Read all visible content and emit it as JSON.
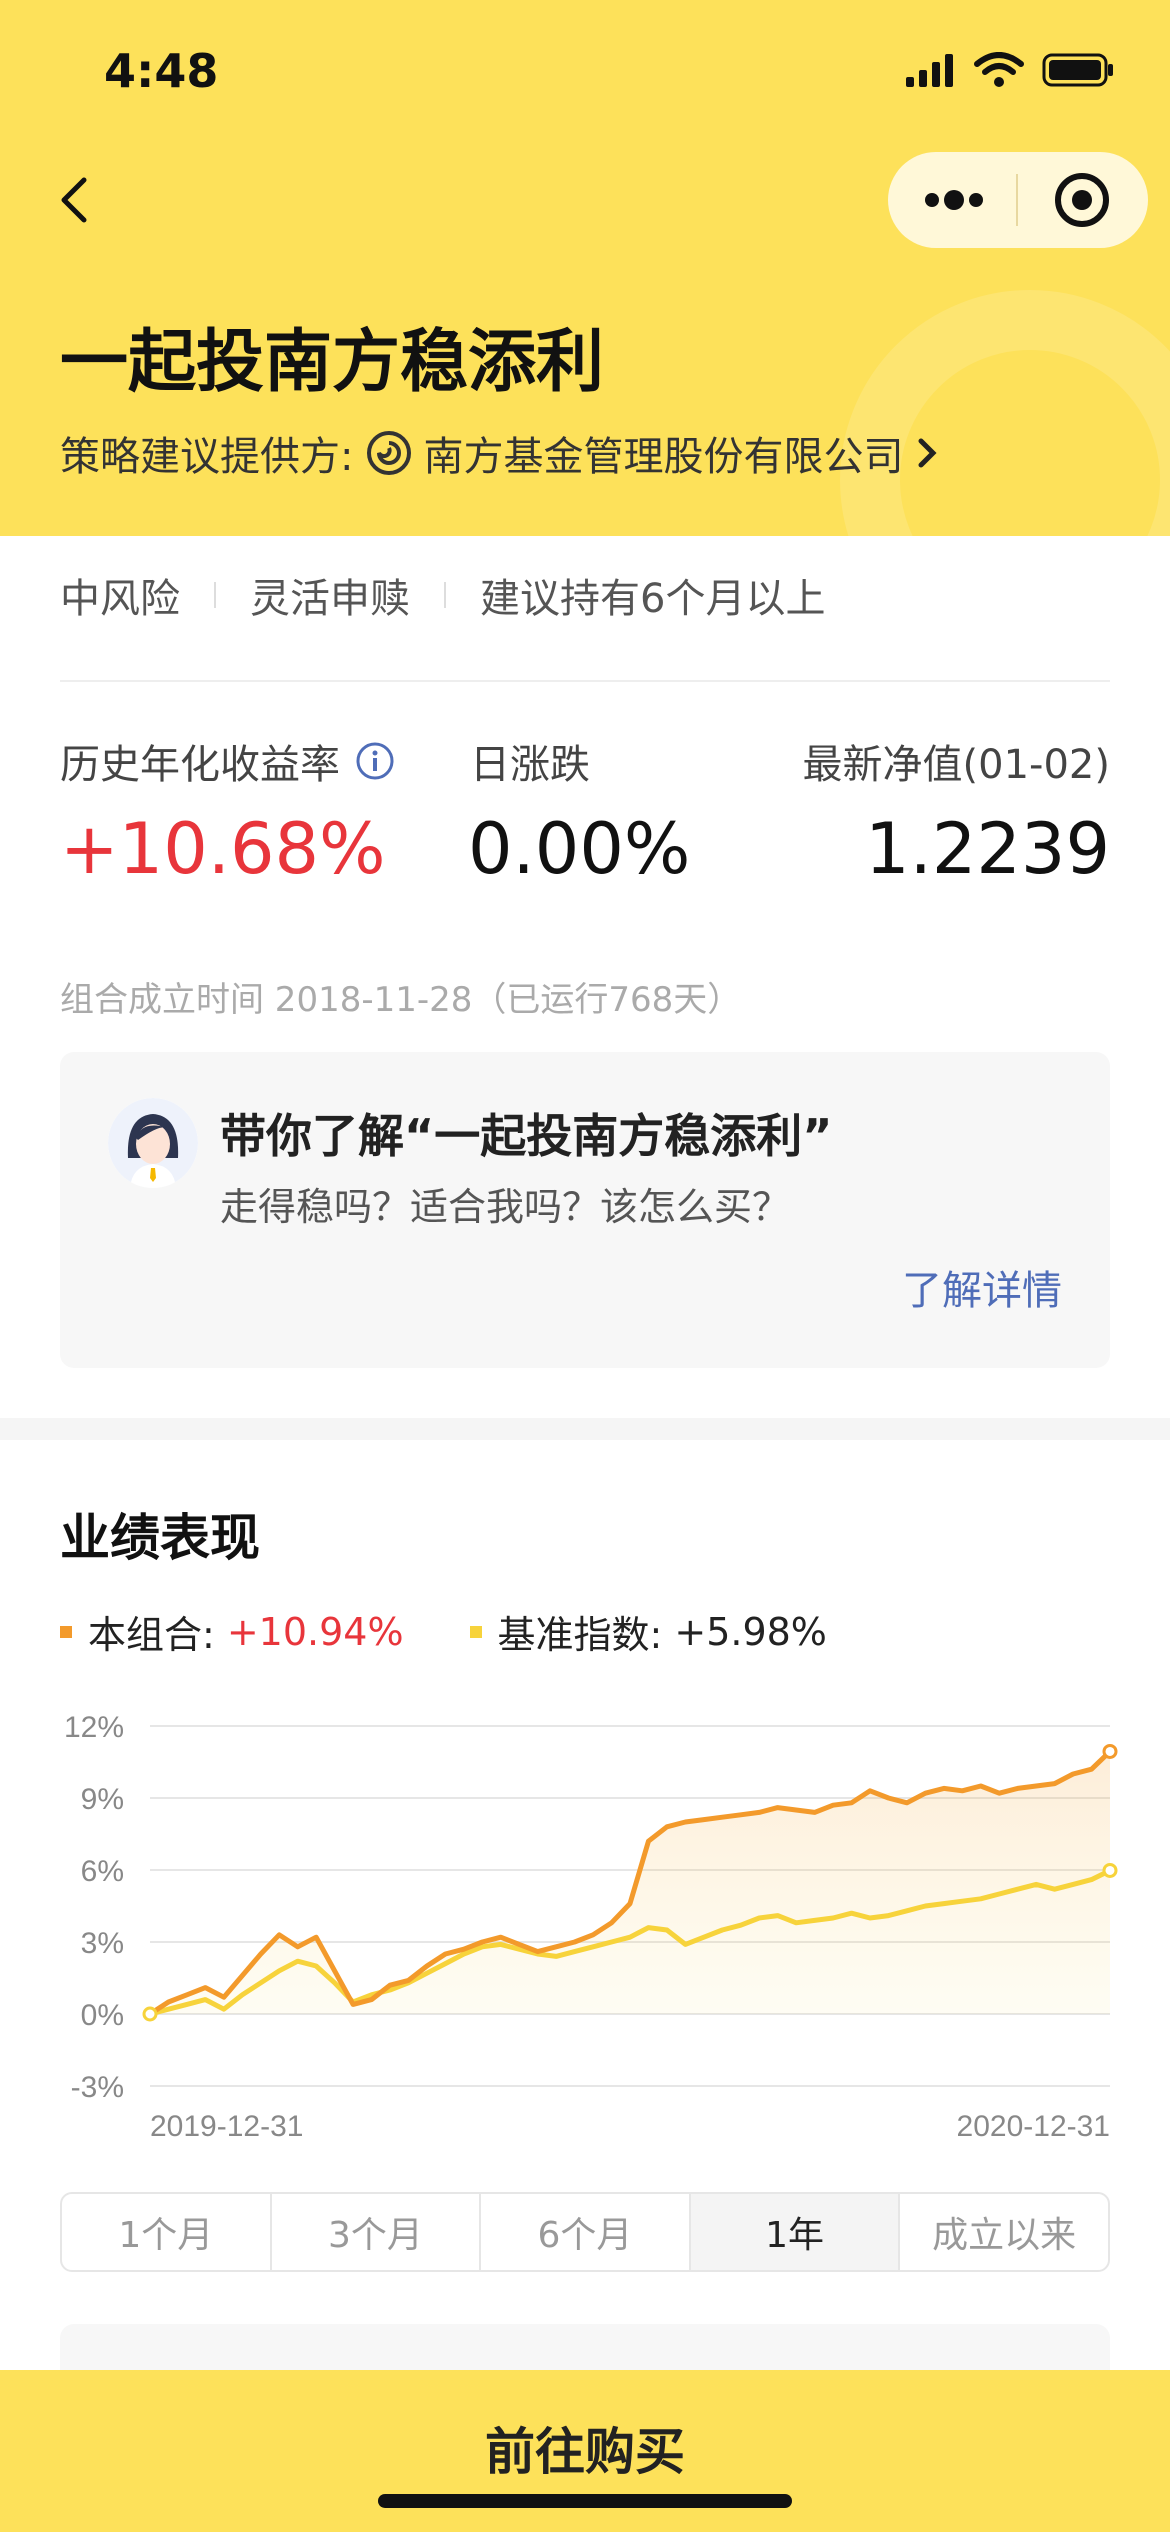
{
  "status_bar": {
    "time": "4:48"
  },
  "header": {
    "title": "一起投南方稳添利",
    "provider_label": "策略建议提供方:",
    "provider_name": "南方基金管理股份有限公司",
    "bg_color": "#fde15a"
  },
  "tags": [
    "中风险",
    "灵活申赎",
    "建议持有6个月以上"
  ],
  "metrics": {
    "annual_label": "历史年化收益率",
    "annual_value": "+10.68%",
    "daily_label": "日涨跌",
    "daily_value": "0.00%",
    "nav_label": "最新净值(01-02)",
    "nav_value": "1.2239"
  },
  "founded": "组合成立时间 2018-11-28（已运行768天）",
  "intro_card": {
    "title": "带你了解“一起投南方稳添利”",
    "subtitle": "走得稳吗？适合我吗？该怎么买？",
    "link": "了解详情"
  },
  "performance": {
    "title": "业绩表现",
    "legend": [
      {
        "name": "本组合:",
        "value": "+10.94%",
        "color": "#f39a2b"
      },
      {
        "name": "基准指数:",
        "value": "+5.98%",
        "color": "#f7d33b"
      }
    ]
  },
  "chart_data": {
    "type": "line",
    "y_ticks": [
      "12%",
      "9%",
      "6%",
      "3%",
      "0%",
      "-3%"
    ],
    "ylim": [
      -3,
      12
    ],
    "x_start_label": "2019-12-31",
    "x_end_label": "2020-12-31",
    "x": [
      "2019-12-31",
      "2020-01-07",
      "2020-01-14",
      "2020-01-21",
      "2020-01-28",
      "2020-02-04",
      "2020-02-11",
      "2020-02-18",
      "2020-02-25",
      "2020-03-03",
      "2020-03-10",
      "2020-03-17",
      "2020-03-24",
      "2020-03-31",
      "2020-04-07",
      "2020-04-14",
      "2020-04-21",
      "2020-04-28",
      "2020-05-05",
      "2020-05-12",
      "2020-05-19",
      "2020-05-26",
      "2020-06-02",
      "2020-06-09",
      "2020-06-16",
      "2020-06-23",
      "2020-06-30",
      "2020-07-07",
      "2020-07-14",
      "2020-07-21",
      "2020-07-28",
      "2020-08-04",
      "2020-08-11",
      "2020-08-18",
      "2020-08-25",
      "2020-09-01",
      "2020-09-08",
      "2020-09-15",
      "2020-09-22",
      "2020-09-29",
      "2020-10-06",
      "2020-10-13",
      "2020-10-20",
      "2020-10-27",
      "2020-11-03",
      "2020-11-10",
      "2020-11-17",
      "2020-11-24",
      "2020-12-01",
      "2020-12-08",
      "2020-12-15",
      "2020-12-22",
      "2020-12-31"
    ],
    "series": [
      {
        "name": "本组合",
        "color": "#f39a2b",
        "values": [
          0.0,
          0.5,
          0.8,
          1.1,
          0.7,
          1.6,
          2.5,
          3.3,
          2.8,
          3.2,
          1.8,
          0.4,
          0.6,
          1.2,
          1.4,
          2.0,
          2.5,
          2.7,
          3.0,
          3.2,
          2.9,
          2.6,
          2.8,
          3.0,
          3.3,
          3.8,
          4.6,
          7.2,
          7.8,
          8.0,
          8.1,
          8.2,
          8.3,
          8.4,
          8.6,
          8.5,
          8.4,
          8.7,
          8.8,
          9.3,
          9.0,
          8.8,
          9.2,
          9.4,
          9.3,
          9.5,
          9.2,
          9.4,
          9.5,
          9.6,
          10.0,
          10.2,
          10.94
        ]
      },
      {
        "name": "基准指数",
        "color": "#f7d33b",
        "values": [
          0.0,
          0.2,
          0.4,
          0.6,
          0.2,
          0.8,
          1.3,
          1.8,
          2.2,
          2.0,
          1.3,
          0.5,
          0.8,
          1.0,
          1.3,
          1.7,
          2.1,
          2.5,
          2.8,
          2.9,
          2.7,
          2.5,
          2.4,
          2.6,
          2.8,
          3.0,
          3.2,
          3.6,
          3.5,
          2.9,
          3.2,
          3.5,
          3.7,
          4.0,
          4.1,
          3.8,
          3.9,
          4.0,
          4.2,
          4.0,
          4.1,
          4.3,
          4.5,
          4.6,
          4.7,
          4.8,
          5.0,
          5.2,
          5.4,
          5.2,
          5.4,
          5.6,
          5.98
        ]
      }
    ]
  },
  "range_tabs": [
    "1个月",
    "3个月",
    "6个月",
    "1年",
    "成立以来"
  ],
  "range_active": 3,
  "buy_button": "前往购买"
}
